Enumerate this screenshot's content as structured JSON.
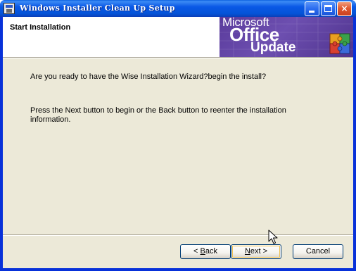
{
  "window": {
    "title": "Windows Installer Clean Up Setup",
    "controls": {
      "minimize": "minimize",
      "maximize": "maximize",
      "close": "×"
    }
  },
  "header": {
    "title": "Start Installation",
    "banner": {
      "line1": "Microsoft",
      "line2": "Office",
      "line3": "Update"
    }
  },
  "body": {
    "question": "Are you ready to have the Wise Installation Wizard?begin the install?",
    "instructions": "Press the Next button to begin or the Back button to reenter the installation information."
  },
  "buttons": {
    "back": {
      "prefix": "< ",
      "mnemonic": "B",
      "rest": "ack"
    },
    "next": {
      "mnemonic": "N",
      "rest": "ext",
      "suffix": " >"
    },
    "cancel": "Cancel"
  },
  "colors": {
    "titlebar": "#0a58e6",
    "client_background": "#ece9d8",
    "banner_purple": "#5a3b9c",
    "default_button_glow": "#f0c050"
  },
  "icons": {
    "app": "installer-app-icon",
    "logo": "office-puzzle-logo",
    "cursor": "mouse-pointer-icon"
  }
}
